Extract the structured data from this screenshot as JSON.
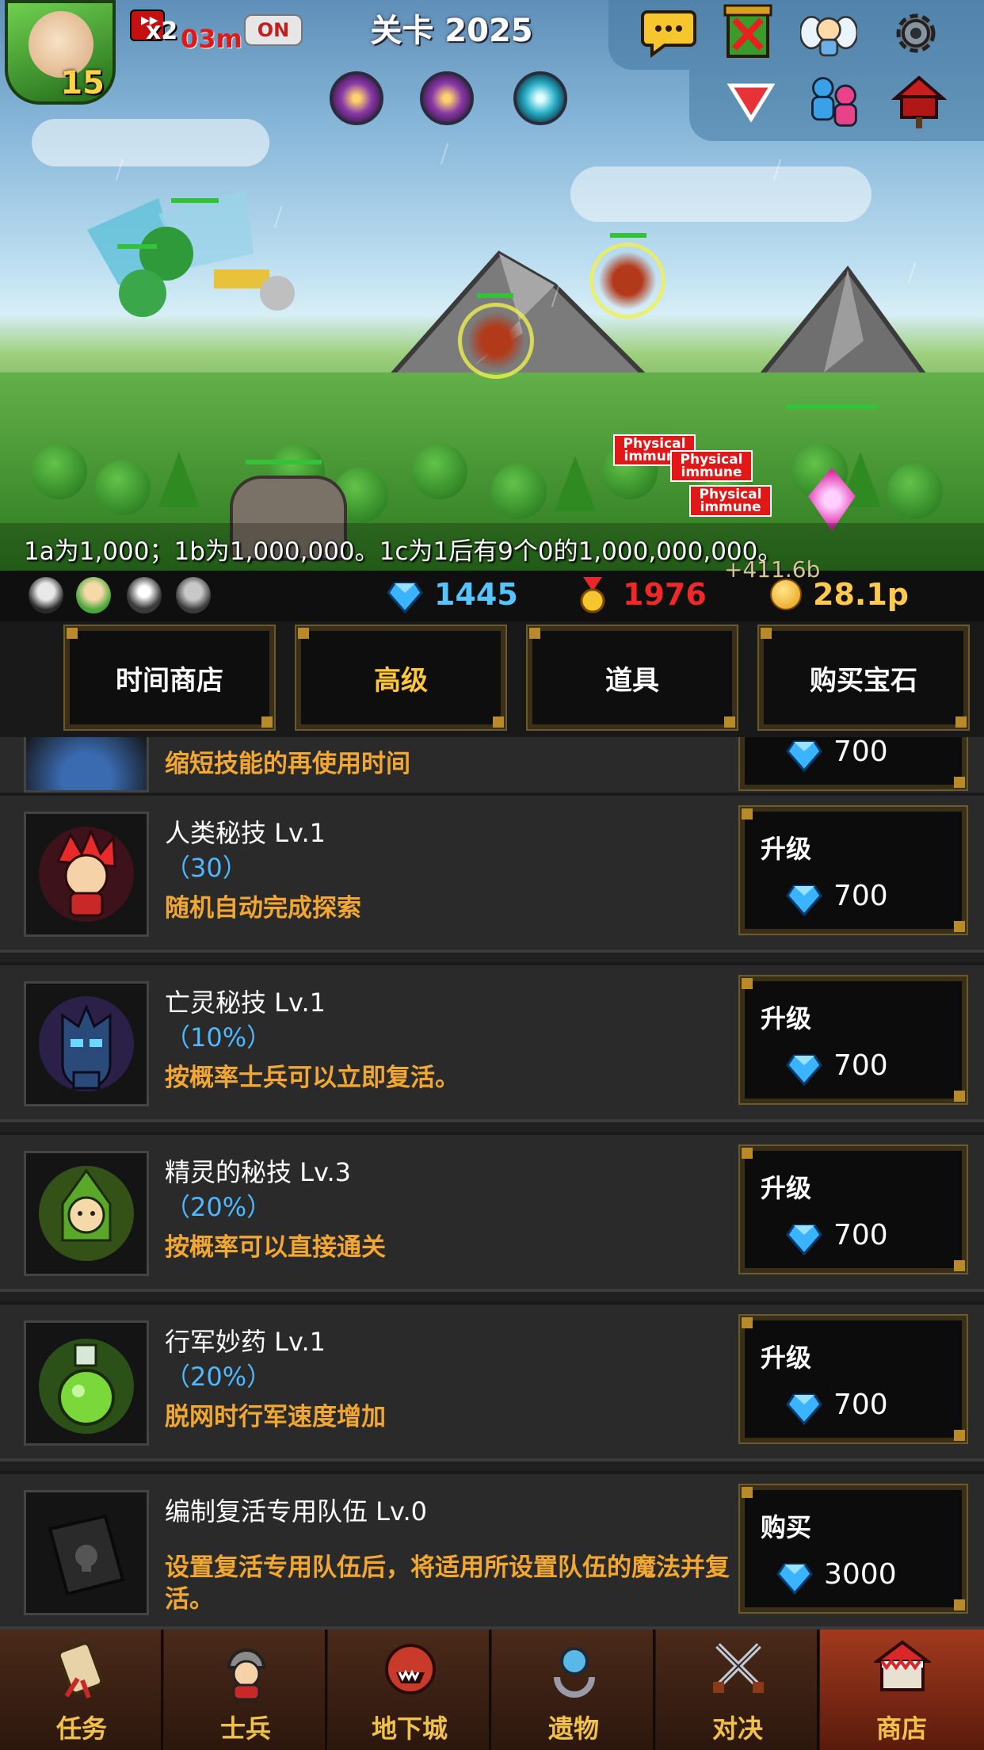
{
  "hud": {
    "player_level": "15",
    "speed_multiplier": "x2",
    "speed_timer": "03m",
    "auto_toggle": "ON",
    "stage_title": "关卡 2025"
  },
  "hint_text": "1a为1,000；1b为1,000,000。1c为1后有9个0的1,000,000,000。",
  "immune_labels": [
    "Physical immune",
    "Physical immune",
    "Physical immune"
  ],
  "resources": {
    "gems": "1445",
    "medals": "1976",
    "gold": "28.1p",
    "gold_gain": "+411.6b"
  },
  "tabs": [
    {
      "label": "时间商店",
      "active": false
    },
    {
      "label": "高级",
      "active": true
    },
    {
      "label": "道具",
      "active": false
    },
    {
      "label": "购买宝石",
      "active": false
    }
  ],
  "partial_row": {
    "desc": "缩短技能的再使用时间",
    "price": "700"
  },
  "items": [
    {
      "name": "人类秘技 Lv.1",
      "value": "（30）",
      "desc": "随机自动完成探索",
      "button": "升级",
      "price": "700"
    },
    {
      "name": "亡灵秘技 Lv.1",
      "value": "（10%）",
      "desc": "按概率士兵可以立即复活。",
      "button": "升级",
      "price": "700"
    },
    {
      "name": "精灵的秘技 Lv.3",
      "value": "（20%）",
      "desc": "按概率可以直接通关",
      "button": "升级",
      "price": "700"
    },
    {
      "name": "行军妙药 Lv.1",
      "value": "（20%）",
      "desc": "脱网时行军速度增加",
      "button": "升级",
      "price": "700"
    },
    {
      "name": "编制复活专用队伍 Lv.0",
      "value": "",
      "desc": "设置复活专用队伍后，将适用所设置队伍的魔法并复活。",
      "button": "购买",
      "price": "3000"
    }
  ],
  "nav": [
    {
      "label": "任务",
      "icon": "scroll-icon",
      "active": false
    },
    {
      "label": "士兵",
      "icon": "soldier-icon",
      "active": false
    },
    {
      "label": "地下城",
      "icon": "dungeon-icon",
      "active": false
    },
    {
      "label": "遗物",
      "icon": "relic-icon",
      "active": false
    },
    {
      "label": "对决",
      "icon": "crossed-swords-icon",
      "active": false
    },
    {
      "label": "商店",
      "icon": "shop-icon",
      "active": true
    }
  ],
  "colors": {
    "gem_blue": "#56c4ff",
    "medal_red": "#f02828",
    "gold": "#ffc94d",
    "desc_orange": "#f2a731",
    "value_blue": "#4db8ff",
    "active_tab": "#ffc83a"
  }
}
